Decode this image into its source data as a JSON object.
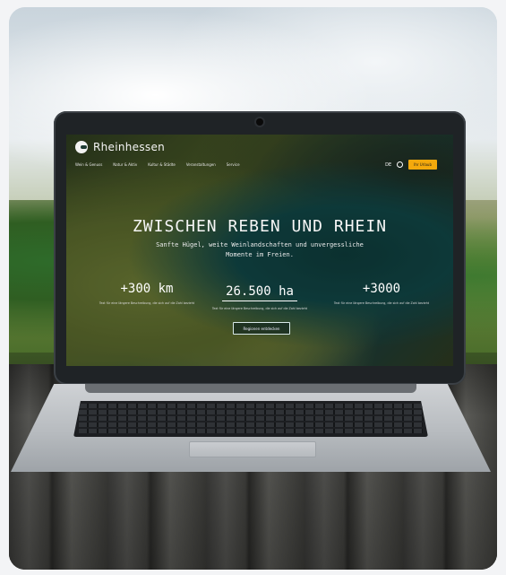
{
  "website": {
    "brand": "Rheinhessen",
    "nav_links": [
      "Wein & Genuss",
      "Natur & Aktiv",
      "Kultur & Städte",
      "Veranstaltungen",
      "Service"
    ],
    "lang": "DE",
    "cta_label": "Ihr Urlaub",
    "hero_title": "ZWISCHEN REBEN UND RHEIN",
    "hero_subtitle": "Sanfte Hügel, weite Weinlandschaften und unvergessliche Momente im Freien.",
    "stats": [
      {
        "value": "+300 km",
        "desc": "Text für eine längere Beschreibung, die sich auf die Zahl bezieht"
      },
      {
        "value": "26.500 ha",
        "desc": "Text für eine längere Beschreibung, die sich auf die Zahl bezieht"
      },
      {
        "value": "+3000",
        "desc": "Text für eine längere Beschreibung, die sich auf die Zahl bezieht"
      }
    ],
    "button_label": "Regionen entdecken"
  },
  "icons": {
    "logo": "logo-mark-icon",
    "search": "search-icon",
    "webcam": "webcam-icon"
  },
  "colors": {
    "cta": "#f4a90c",
    "screen_teal": "#114646"
  }
}
